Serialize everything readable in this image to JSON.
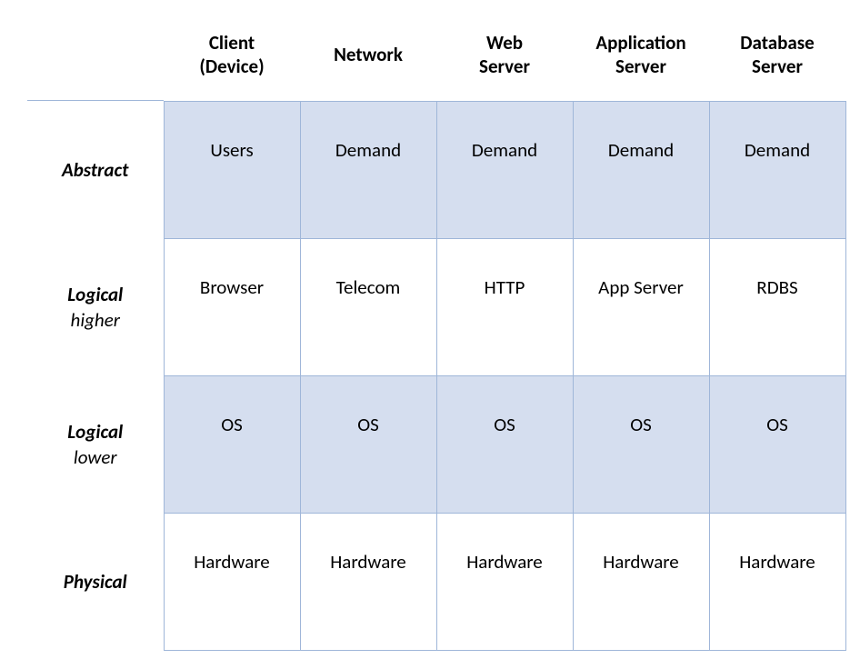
{
  "columns": [
    "Client\n(Device)",
    "Network",
    "Web\nServer",
    "Application\nServer",
    "Database\nServer"
  ],
  "rows": [
    {
      "label": "Abstract",
      "sublabel": ""
    },
    {
      "label": "Logical",
      "sublabel": "higher"
    },
    {
      "label": "Logical",
      "sublabel": "lower"
    },
    {
      "label": "Physical",
      "sublabel": ""
    }
  ],
  "cells": [
    [
      "Users",
      "Demand",
      "Demand",
      "Demand",
      "Demand"
    ],
    [
      "Browser",
      "Telecom",
      "HTTP",
      "App Server",
      "RDBS"
    ],
    [
      "OS",
      "OS",
      "OS",
      "OS",
      "OS"
    ],
    [
      "Hardware",
      "Hardware",
      "Hardware",
      "Hardware",
      "Hardware"
    ]
  ],
  "chart_data": {
    "type": "table",
    "title": "",
    "columns": [
      "Client (Device)",
      "Network",
      "Web Server",
      "Application Server",
      "Database Server"
    ],
    "rows": [
      "Abstract",
      "Logical higher",
      "Logical lower",
      "Physical"
    ],
    "values": [
      [
        "Users",
        "Demand",
        "Demand",
        "Demand",
        "Demand"
      ],
      [
        "Browser",
        "Telecom",
        "HTTP",
        "App Server",
        "RDBS"
      ],
      [
        "OS",
        "OS",
        "OS",
        "OS",
        "OS"
      ],
      [
        "Hardware",
        "Hardware",
        "Hardware",
        "Hardware",
        "Hardware"
      ]
    ]
  }
}
